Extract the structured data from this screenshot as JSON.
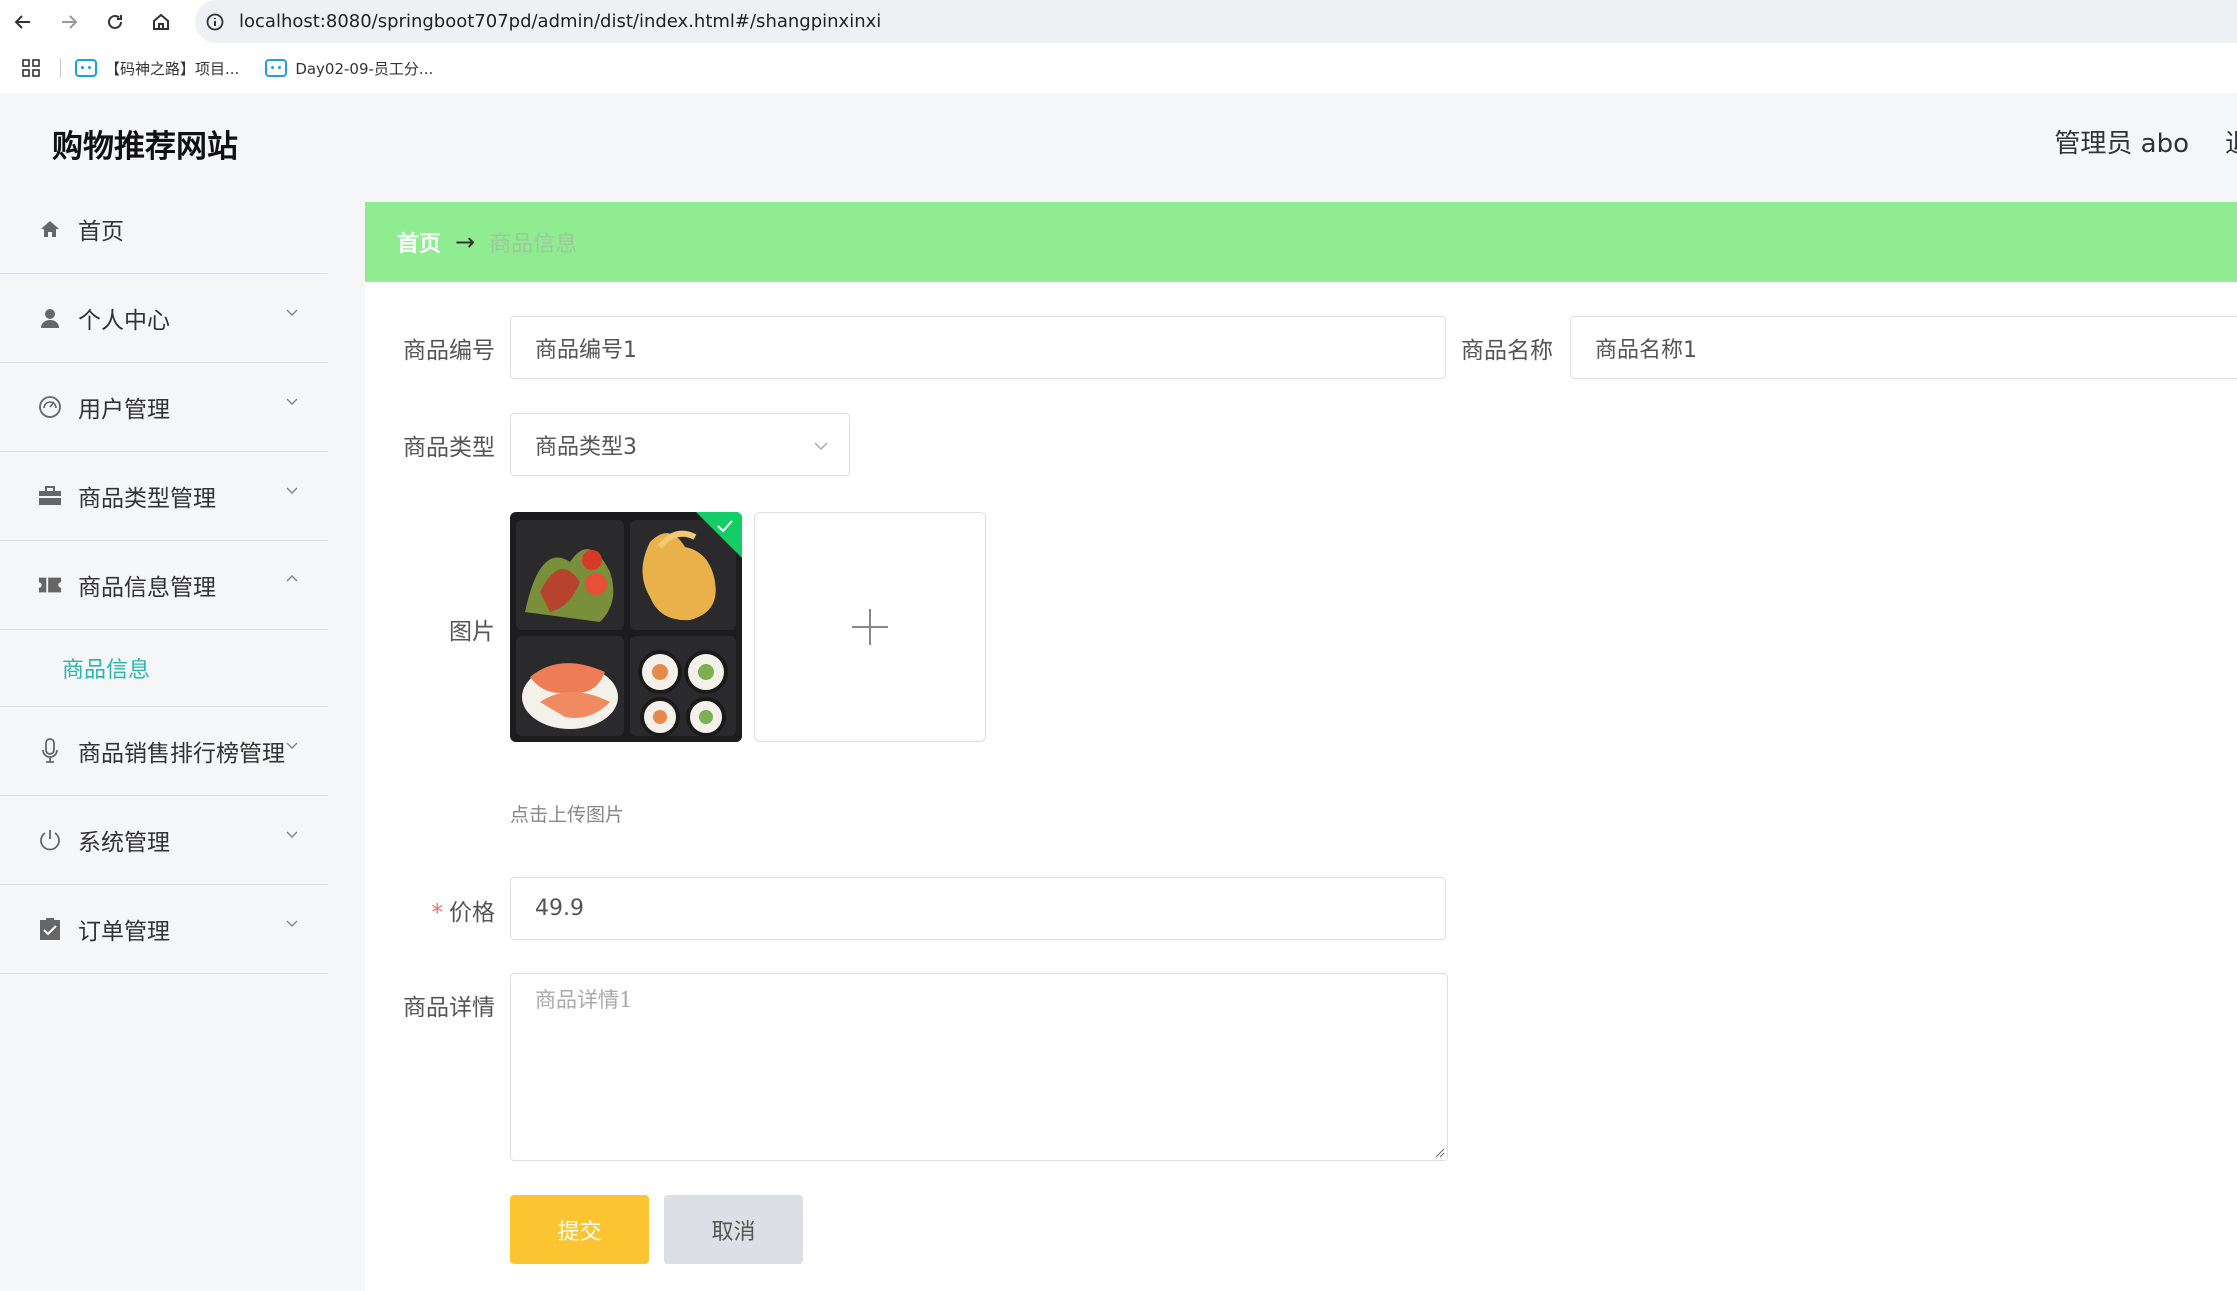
{
  "browser": {
    "url": "localhost:8080/springboot707pd/admin/dist/index.html#/shangpinxinxi",
    "bookmarks": [
      {
        "label": "【码神之路】项目..."
      },
      {
        "label": "Day02-09-员工分..."
      }
    ]
  },
  "header": {
    "title": "购物推荐网站",
    "user": "管理员 abo",
    "logout": "退"
  },
  "sidebar": {
    "items": [
      {
        "label": "首页",
        "icon": "home-icon"
      },
      {
        "label": "个人中心",
        "icon": "user-icon"
      },
      {
        "label": "用户管理",
        "icon": "gauge-icon"
      },
      {
        "label": "商品类型管理",
        "icon": "briefcase-icon"
      },
      {
        "label": "商品信息管理",
        "icon": "ticket-icon"
      },
      {
        "label": "商品销售排行榜管理",
        "icon": "microphone-icon"
      },
      {
        "label": "系统管理",
        "icon": "power-icon"
      },
      {
        "label": "订单管理",
        "icon": "clipboard-icon"
      }
    ],
    "submenu": {
      "label": "商品信息"
    }
  },
  "breadcrumb": {
    "home": "首页",
    "arrow": "→",
    "current": "商品信息"
  },
  "form": {
    "code": {
      "label": "商品编号",
      "value": "商品编号1"
    },
    "name": {
      "label": "商品名称",
      "value": "商品名称1"
    },
    "type": {
      "label": "商品类型",
      "value": "商品类型3"
    },
    "image": {
      "label": "图片",
      "tip": "点击上传图片"
    },
    "price": {
      "required": "*",
      "label": "价格",
      "value": "49.9"
    },
    "detail": {
      "label": "商品详情",
      "value": "商品详情1"
    },
    "submit": "提交",
    "cancel": "取消"
  },
  "colors": {
    "breadcrumb_bg": "#90ec90",
    "accent": "#2cb5ac",
    "submit": "#fbc531",
    "success": "#13ce66"
  }
}
